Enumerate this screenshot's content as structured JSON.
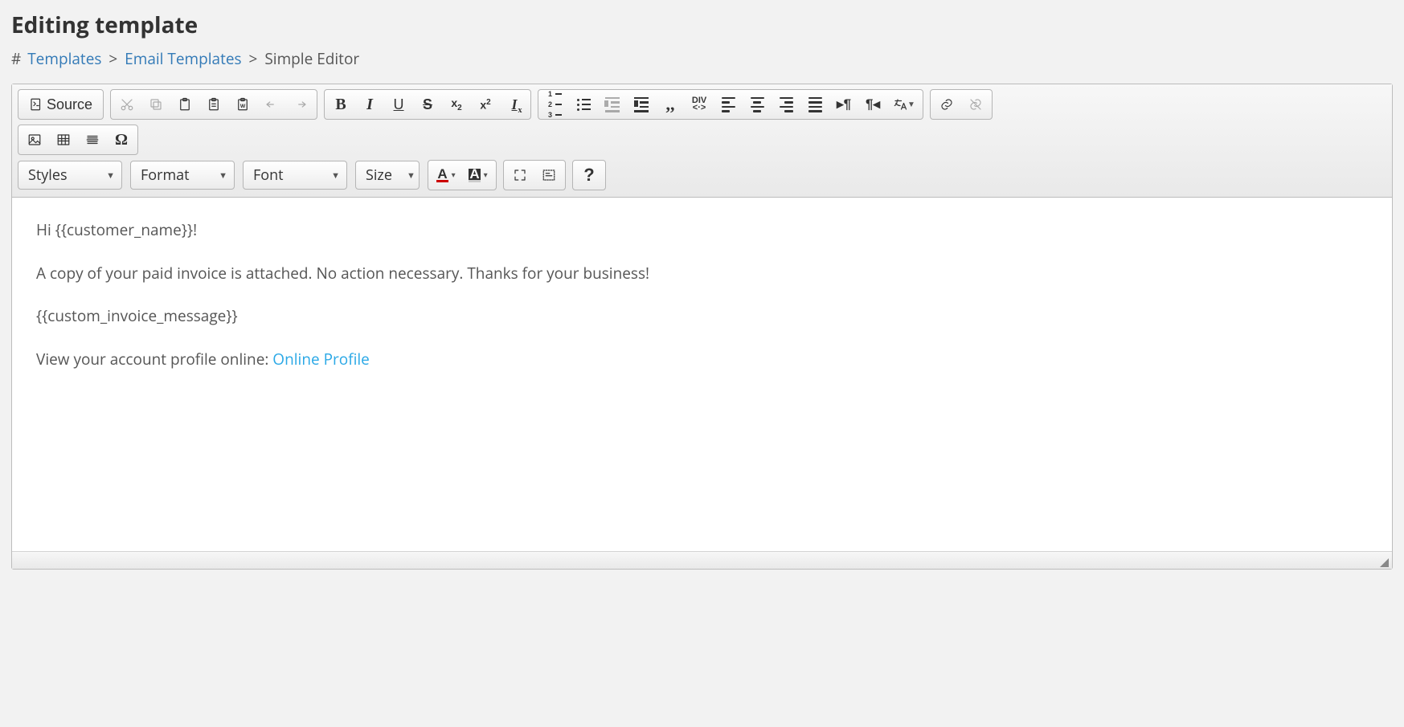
{
  "page": {
    "title": "Editing template"
  },
  "breadcrumb": {
    "hash": "#",
    "items": [
      {
        "label": "Templates",
        "link": true
      },
      {
        "label": "Email Templates",
        "link": true
      },
      {
        "label": "Simple Editor",
        "link": false
      }
    ],
    "sep": ">"
  },
  "toolbar": {
    "source_label": "Source",
    "combos": {
      "styles": "Styles",
      "format": "Format",
      "font": "Font",
      "size": "Size"
    }
  },
  "content": {
    "p1": "Hi {{customer_name}}!",
    "p2": "A copy of your paid invoice is attached. No action necessary. Thanks for your business!",
    "p3": "{{custom_invoice_message}}",
    "p4_prefix": "View your account profile online: ",
    "p4_link": "Online Profile"
  }
}
